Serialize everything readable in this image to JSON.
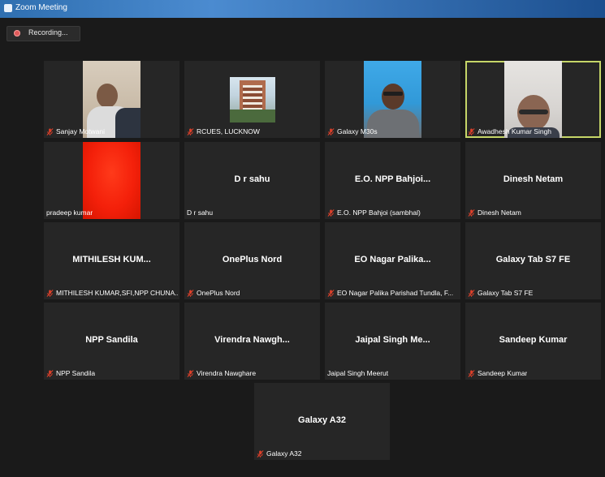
{
  "window": {
    "title": "Zoom Meeting"
  },
  "recording": {
    "label": "Recording..."
  },
  "participants": [
    {
      "display_name": "",
      "caption": "Sanjay Motwani",
      "muted": true,
      "video": "person-light"
    },
    {
      "display_name": "",
      "caption": "RCUES, LUCKNOW",
      "muted": true,
      "video": "building"
    },
    {
      "display_name": "",
      "caption": "Galaxy M30s",
      "muted": true,
      "video": "person-blue"
    },
    {
      "display_name": "",
      "caption": "Awadhesh Kumar Singh",
      "muted": true,
      "video": "person-gray",
      "active": true
    },
    {
      "display_name": "",
      "caption": "pradeep kumar",
      "muted": false,
      "video": "red"
    },
    {
      "display_name": "D r sahu",
      "caption": "D r sahu",
      "muted": false
    },
    {
      "display_name": "E.O. NPP Bahjoi...",
      "caption": "E.O. NPP Bahjoi (sambhal)",
      "muted": true
    },
    {
      "display_name": "Dinesh Netam",
      "caption": "Dinesh Netam",
      "muted": true
    },
    {
      "display_name": "MITHILESH  KUM...",
      "caption": "MITHILESH KUMAR,SFI,NPP CHUNA...",
      "muted": true
    },
    {
      "display_name": "OnePlus Nord",
      "caption": "OnePlus Nord",
      "muted": true
    },
    {
      "display_name": "EO Nagar Palika...",
      "caption": "EO Nagar Palika Parishad Tundla, F...",
      "muted": true
    },
    {
      "display_name": "Galaxy Tab S7 FE",
      "caption": "Galaxy Tab S7 FE",
      "muted": true
    },
    {
      "display_name": "NPP Sandila",
      "caption": "NPP Sandila",
      "muted": true
    },
    {
      "display_name": "Virendra  Nawgh...",
      "caption": "Virendra Nawghare",
      "muted": true
    },
    {
      "display_name": "Jaipal Singh Me...",
      "caption": "Jaipal Singh Meerut",
      "muted": false
    },
    {
      "display_name": "Sandeep Kumar",
      "caption": "Sandeep Kumar",
      "muted": true
    },
    {
      "display_name": "Galaxy A32",
      "caption": "Galaxy A32",
      "muted": true
    }
  ],
  "colors": {
    "background": "#1a1a1a",
    "tile": "#262626",
    "active_speaker": "#c6d668",
    "mic_muted": "#e0402a"
  },
  "icons": {
    "mic_muted": "mic-muted-icon",
    "recording": "record-dot-icon"
  }
}
